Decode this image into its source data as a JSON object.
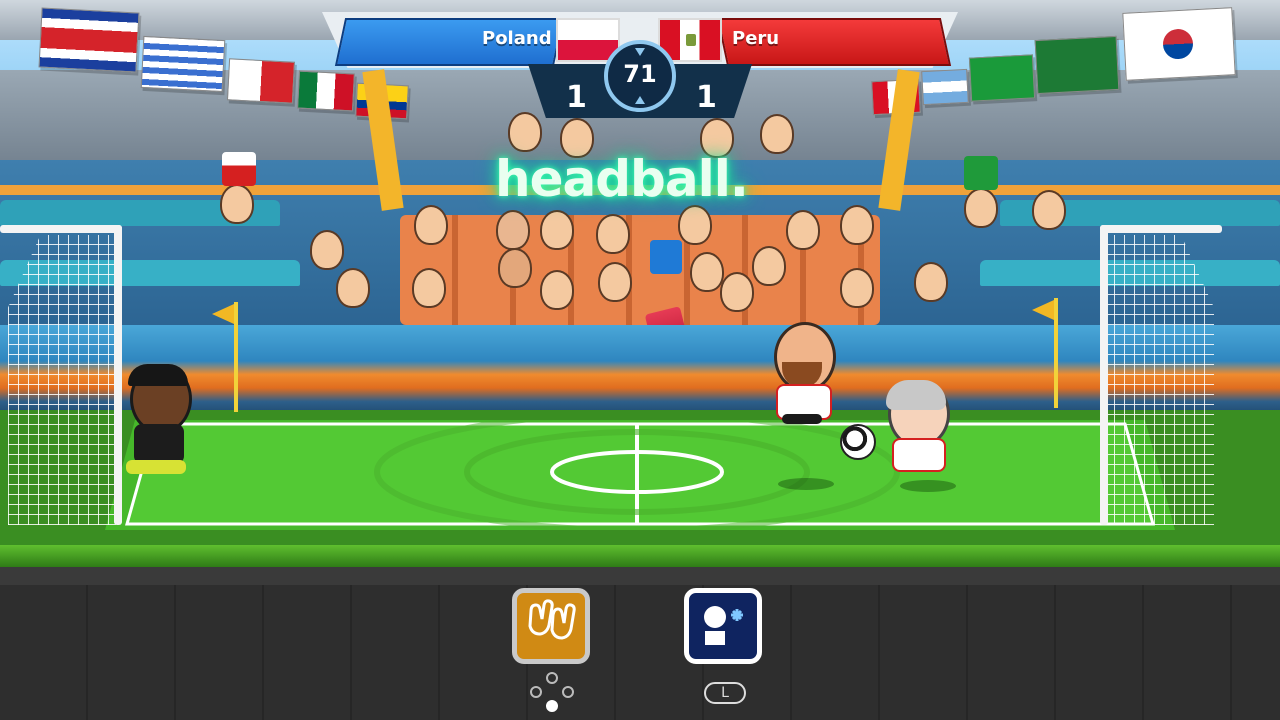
{
  "game": {
    "logo_text": "headball.",
    "timer": "71",
    "home": {
      "name": "Poland",
      "score": "1",
      "color": "#2b86e6"
    },
    "away": {
      "name": "Peru",
      "score": "1",
      "color": "#e02525"
    }
  },
  "controls": {
    "gloves_button": {
      "icon": "gloves-icon",
      "color": "#d08a14"
    },
    "freeze_button": {
      "icon": "freeze-player-icon",
      "color": "#0f2460"
    },
    "freeze_hint": "L",
    "gloves_hint_icon": "face-buttons-icon"
  },
  "background_flags": [
    "Costa Rica",
    "Uruguay",
    "Panama",
    "Mexico",
    "Colombia",
    "Peru",
    "Argentina",
    "Brazil",
    "Saudi Arabia",
    "South Korea"
  ]
}
